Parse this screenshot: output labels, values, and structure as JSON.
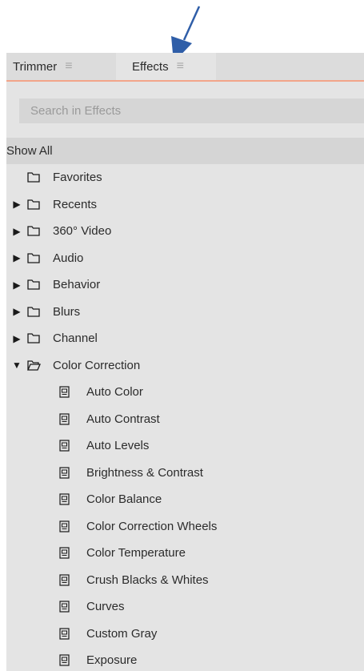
{
  "tabs": [
    {
      "label": "Trimmer",
      "menu": "≡"
    },
    {
      "label": "Effects",
      "menu": "≡"
    }
  ],
  "search": {
    "placeholder": "Search in Effects"
  },
  "show_all_label": "Show All",
  "folders": [
    {
      "label": "Favorites",
      "caret": ""
    },
    {
      "label": "Recents",
      "caret": "▶"
    },
    {
      "label": "360° Video",
      "caret": "▶"
    },
    {
      "label": "Audio",
      "caret": "▶"
    },
    {
      "label": "Behavior",
      "caret": "▶"
    },
    {
      "label": "Blurs",
      "caret": "▶"
    },
    {
      "label": "Channel",
      "caret": "▶"
    },
    {
      "label": "Color Correction",
      "caret": "▼"
    }
  ],
  "color_correction_items": [
    "Auto Color",
    "Auto Contrast",
    "Auto Levels",
    "Brightness & Contrast",
    "Color Balance",
    "Color Correction Wheels",
    "Color Temperature",
    "Crush Blacks & Whites",
    "Curves",
    "Custom Gray",
    "Exposure"
  ],
  "colors": {
    "accent": "#f2a58a",
    "arrow": "#2f5ea8"
  }
}
